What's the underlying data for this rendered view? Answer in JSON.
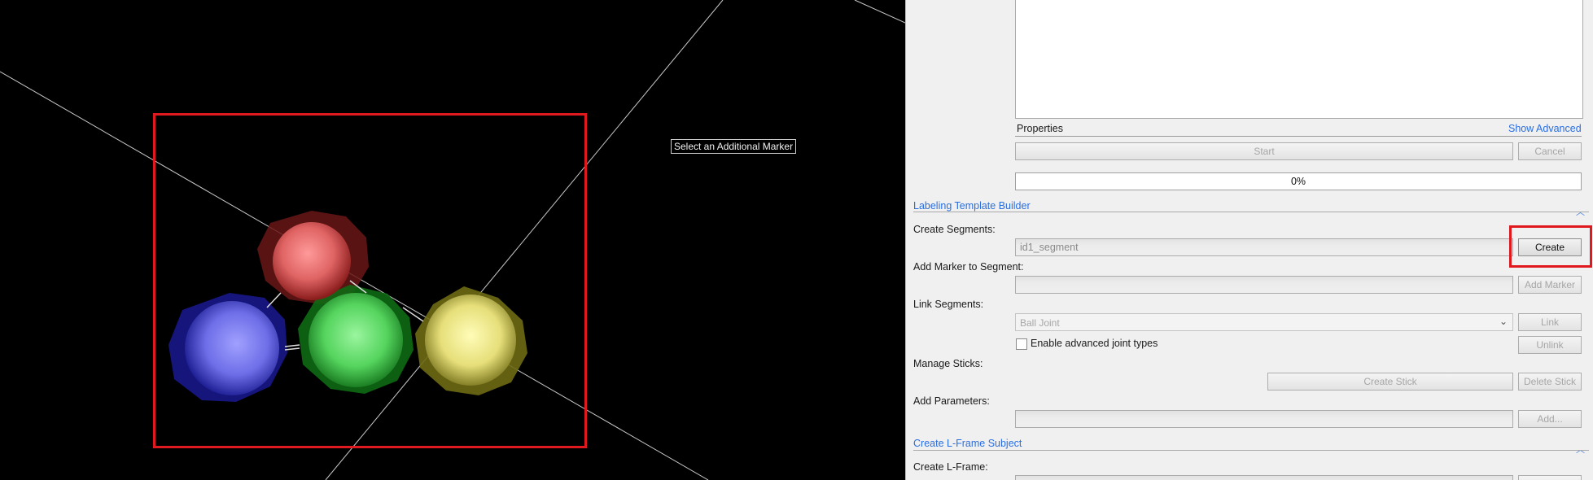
{
  "viewport": {
    "tooltip": "Select an Additional Marker",
    "markers": [
      {
        "name": "red-marker",
        "color": "#e86a6a"
      },
      {
        "name": "blue-marker",
        "color": "#6b6be8"
      },
      {
        "name": "green-marker",
        "color": "#5fe06a"
      },
      {
        "name": "yellow-marker",
        "color": "#e8e06a"
      }
    ],
    "highlight_color": "#e0191e"
  },
  "panel": {
    "properties_label": "Properties",
    "show_advanced_link": "Show Advanced",
    "start_button": "Start",
    "cancel_button": "Cancel",
    "progress_text": "0%",
    "labeling_section": {
      "title": "Labeling Template Builder",
      "create_segments_label": "Create Segments:",
      "segment_name_value": "id1_segment",
      "create_button": "Create",
      "add_marker_label": "Add Marker to Segment:",
      "add_marker_button": "Add Marker",
      "link_segments_label": "Link Segments:",
      "joint_type_value": "Ball Joint",
      "link_button": "Link",
      "enable_advanced_label": "Enable advanced joint types",
      "unlink_button": "Unlink",
      "manage_sticks_label": "Manage Sticks:",
      "create_stick_button": "Create Stick",
      "delete_stick_button": "Delete Stick",
      "add_parameters_label": "Add Parameters:",
      "add_param_button": "Add..."
    },
    "lframe_section": {
      "title": "Create L-Frame Subject",
      "create_lframe_label": "Create L-Frame:"
    }
  }
}
